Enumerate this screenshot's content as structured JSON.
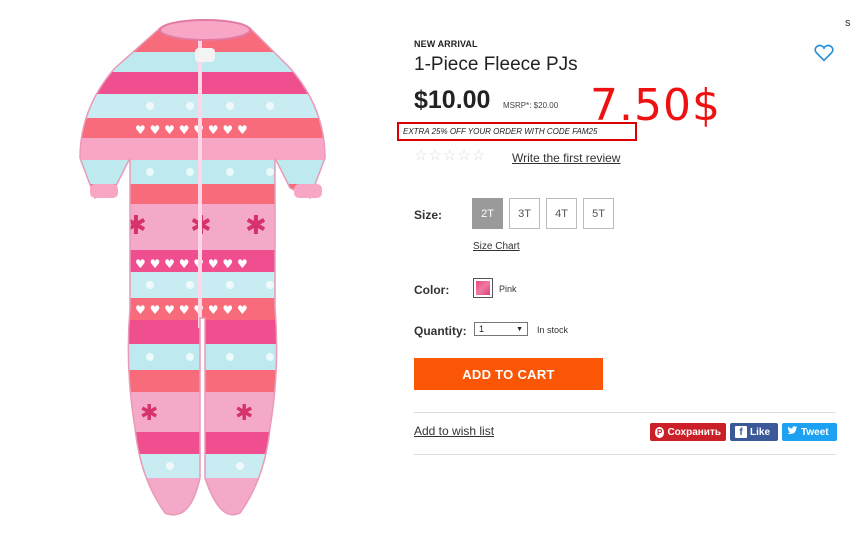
{
  "product": {
    "badge": "NEW ARRIVAL",
    "title": "1-Piece Fleece PJs",
    "price": "$10.00",
    "msrp": "MSRP*: $20.00",
    "promo": "EXTRA 25% OFF YOUR ORDER WITH CODE FAM25",
    "annotation": "7.50$",
    "corner_text": "s"
  },
  "reviews": {
    "stars": [
      "☆",
      "☆",
      "☆",
      "☆",
      "☆"
    ],
    "rating": 0,
    "link": "Write the first review"
  },
  "size": {
    "label": "Size:",
    "options": [
      "2T",
      "3T",
      "4T",
      "5T"
    ],
    "selected": "2T",
    "chart_link": "Size Chart"
  },
  "color": {
    "label": "Color:",
    "name": "Pink",
    "swatch_hex": "#e94c86"
  },
  "quantity": {
    "label": "Quantity:",
    "value": "1",
    "stock": "In stock"
  },
  "actions": {
    "add_to_cart": "ADD TO CART",
    "wishlist": "Add to wish list",
    "pinterest": "Сохранить",
    "facebook": "Like",
    "twitter": "Tweet"
  },
  "colors": {
    "cart": "#fa5606",
    "annotation": "#ee1111",
    "pinterest": "#cb2027",
    "facebook": "#3b5998",
    "twitter": "#1da1f2"
  }
}
